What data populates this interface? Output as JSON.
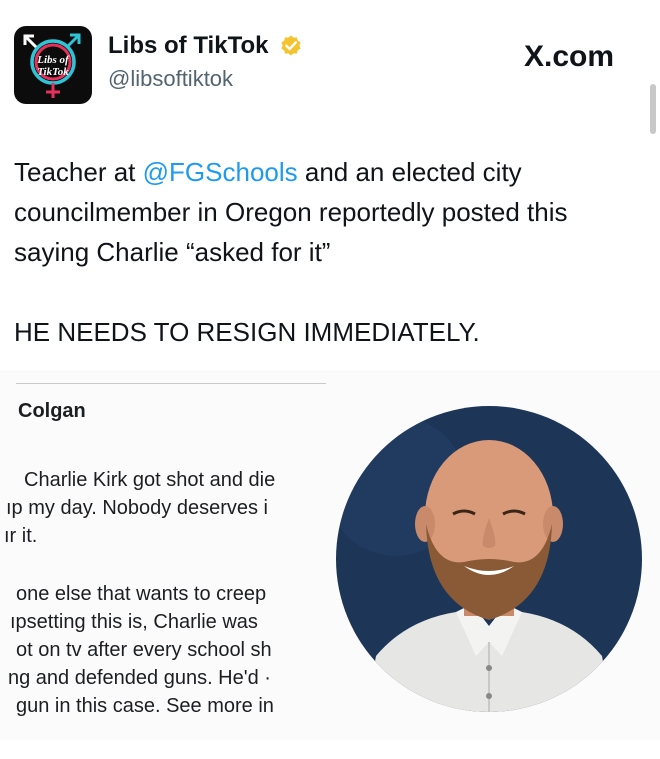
{
  "account": {
    "display_name": "Libs of TikTok",
    "handle": "@libsoftiktok",
    "avatar_text_line1": "Libs of",
    "avatar_text_line2": "TikTok",
    "verified_color": "#f4c430"
  },
  "site": {
    "label": "X.com"
  },
  "tweet": {
    "pre_mention": "Teacher at ",
    "mention": "@FGSchools",
    "post_mention": " and an elected city councilmember in Oregon reportedly posted this saying Charlie “asked for it”",
    "second_paragraph": "HE NEEDS TO RESIGN IMMEDIATELY.",
    "mention_color": "#1d9bf0"
  },
  "embedded_post": {
    "author": "Colgan",
    "paragraph1": [
      "Charlie Kirk got shot and die",
      "ıp my day. Nobody deserves i",
      "ır it."
    ],
    "paragraph2": [
      "one else that wants to creep",
      "ıpsetting this is, Charlie was",
      "ot on tv after every school sh",
      "ng and defended guns. He'd ·",
      "gun in this case. See more in"
    ]
  },
  "icons": {
    "avatar": "libs-of-tiktok-logo",
    "verified": "verified-badge-icon",
    "portrait": "profile-photo"
  }
}
